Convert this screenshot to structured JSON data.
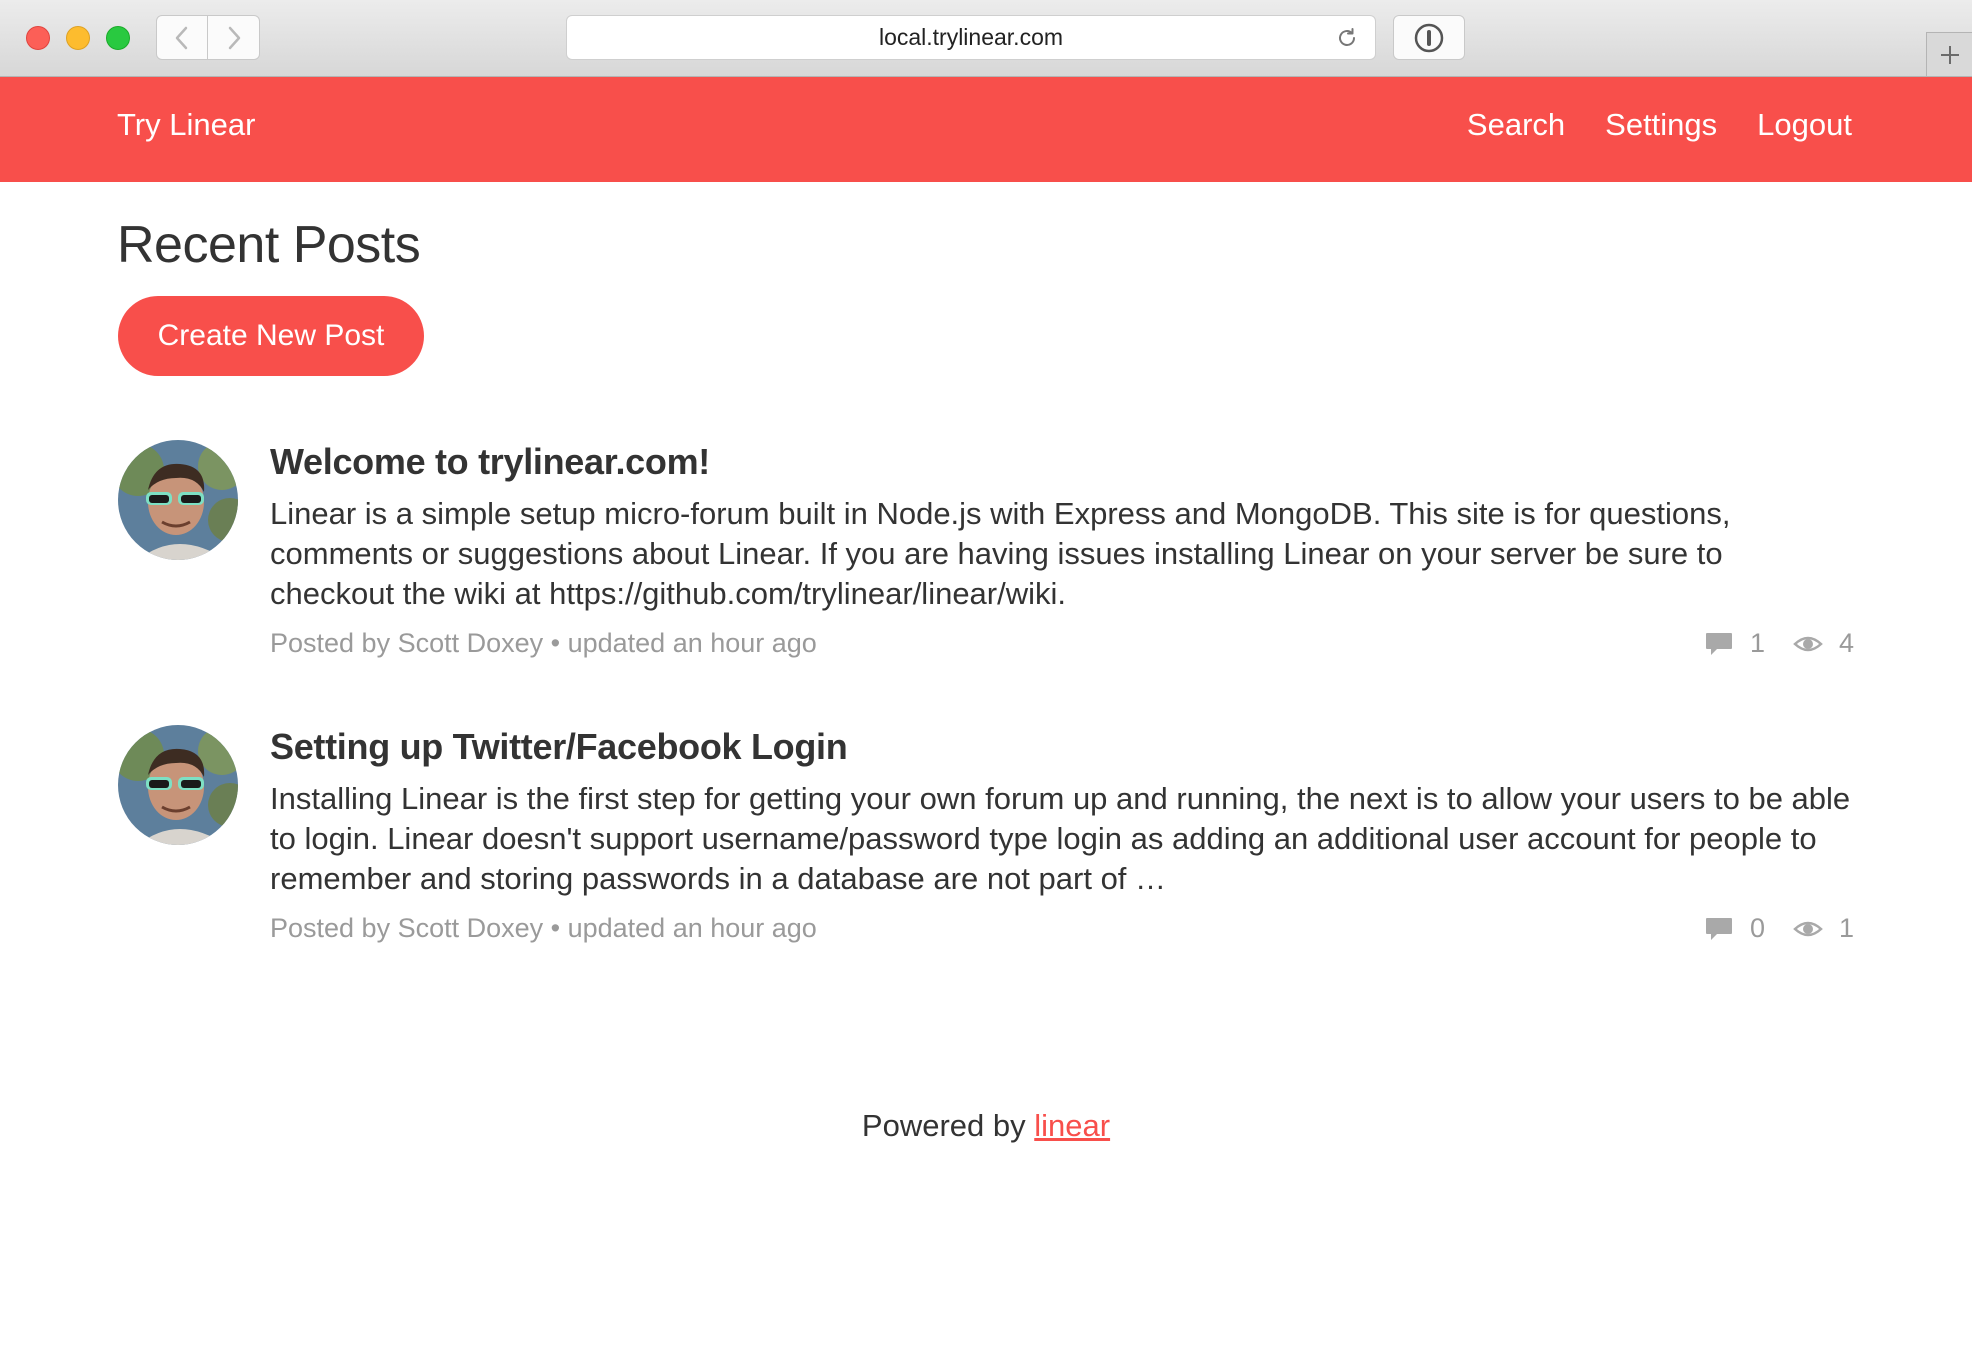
{
  "browser": {
    "url": "local.trylinear.com"
  },
  "navbar": {
    "brand": "Try Linear",
    "links": [
      "Search",
      "Settings",
      "Logout"
    ]
  },
  "main": {
    "title": "Recent Posts",
    "create_button": "Create New Post",
    "posts": [
      {
        "title": "Welcome to trylinear.com!",
        "excerpt": "Linear is a simple setup micro-forum built in Node.js with Express and MongoDB. This site is for questions, comments or suggestions about Linear. If you are having issues installing Linear on your server be sure to checkout the wiki at https://github.com/trylinear/linear/wiki.",
        "meta": "Posted by Scott Doxey • updated an hour ago",
        "comments": "1",
        "views": "4"
      },
      {
        "title": "Setting up Twitter/Facebook Login",
        "excerpt": "Installing Linear is the first step for getting your own forum up and running, the next is to allow your users to be able to login. Linear doesn't support username/password type login as adding an additional user account for people to remember and storing passwords in a database are not part of …",
        "meta": "Posted by Scott Doxey • updated an hour ago",
        "comments": "0",
        "views": "1"
      }
    ]
  },
  "footer": {
    "prefix": "Powered by",
    "link": "linear"
  },
  "icons": {
    "comments": "speech-bubble-icon",
    "views": "eye-icon"
  },
  "colors": {
    "accent": "#f84f4b",
    "meta_text": "#9a9a9a",
    "body_text": "#333333"
  }
}
